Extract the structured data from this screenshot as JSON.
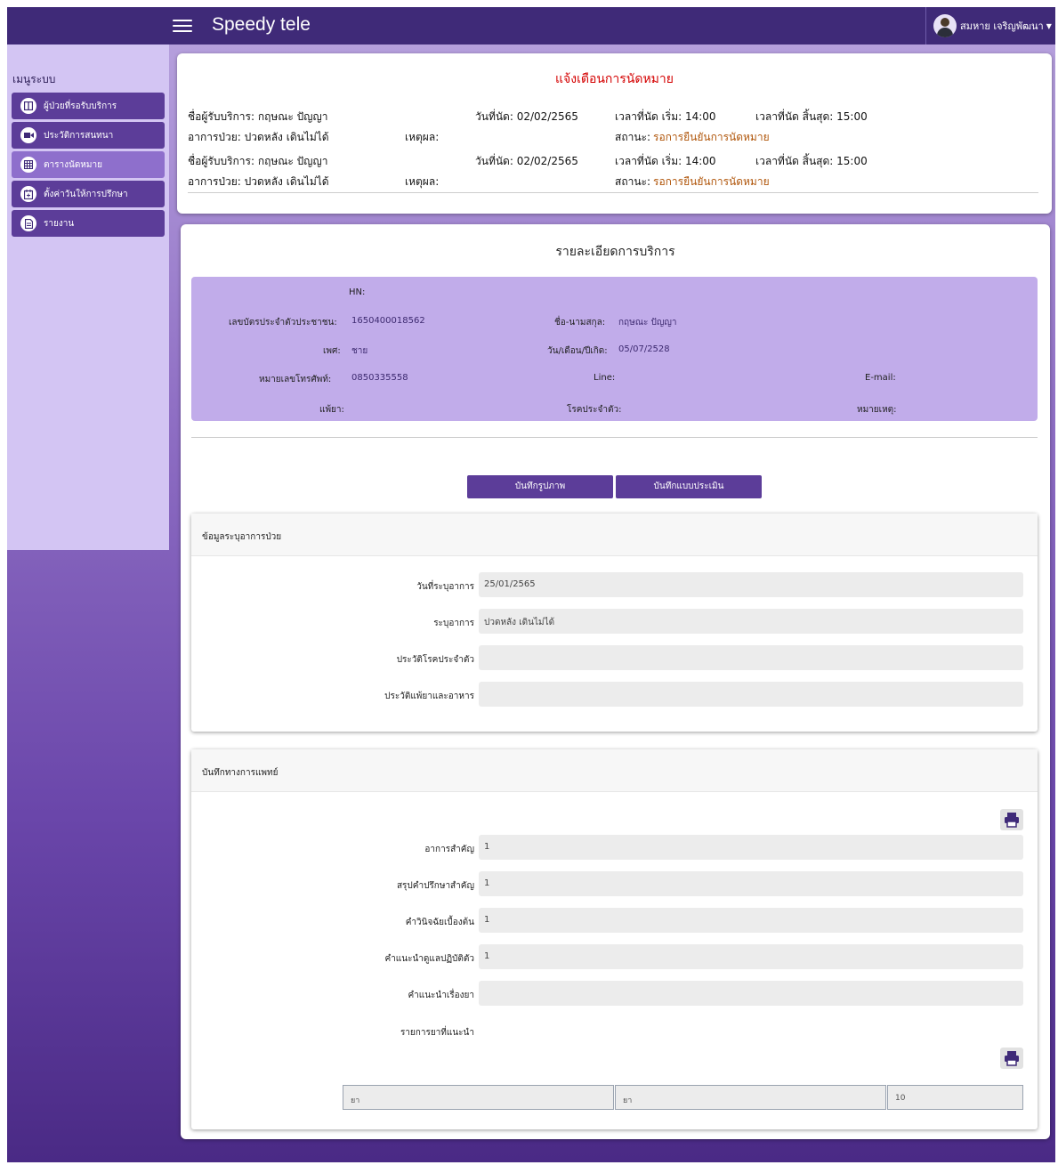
{
  "app": {
    "title": "Speedy tele",
    "user": "สมหาย เจริญพัฒนา"
  },
  "sidebar": {
    "title": "เมนูระบบ",
    "items": [
      {
        "label": "ผู้ป่วยที่รอรับบริการ",
        "icon": "columns-icon"
      },
      {
        "label": "ประวัติการสนทนา",
        "icon": "video-icon"
      },
      {
        "label": "ตารางนัดหมาย",
        "icon": "calendar-grid-icon"
      },
      {
        "label": "ตั้งค่าวันให้การปรึกษา",
        "icon": "calendar-plus-icon"
      },
      {
        "label": "รายงาน",
        "icon": "document-icon"
      }
    ]
  },
  "alert": {
    "title": "แจ้งเตือนการนัดหมาย",
    "rows": [
      {
        "client": "ชื่อผู้รับบริการ: กฤษณะ ปัญญา",
        "date": "วันที่นัด: 02/02/2565",
        "start": "เวลาที่นัด เริ่ม: 14:00",
        "end": "เวลาที่นัด สิ้นสุด: 15:00",
        "symptom": "อาการป่วย: ปวดหลัง เดินไม่ได้",
        "reason": "เหตุผล:",
        "status_label": "สถานะ:",
        "status_value": "รอการยืนยันการนัดหมาย"
      },
      {
        "client": "ชื่อผู้รับบริการ: กฤษณะ ปัญญา",
        "date": "วันที่นัด: 02/02/2565",
        "start": "เวลาที่นัด เริ่ม: 14:00",
        "end": "เวลาที่นัด สิ้นสุด: 15:00",
        "symptom": "อาการป่วย: ปวดหลัง เดินไม่ได้",
        "reason": "เหตุผล:",
        "status_label": "สถานะ:",
        "status_value": "รอการยืนยันการนัดหมาย"
      }
    ]
  },
  "detail": {
    "title": "รายละเอียดการบริการ",
    "patient": {
      "hn_label": "HN:",
      "id_label": "เลขบัตรประจำตัวประชาชน:",
      "id_value": "1650400018562",
      "name_label": "ชื่อ-นามสกุล:",
      "name_value": "กฤษณะ ปัญญา",
      "sex_label": "เพศ:",
      "sex_value": "ชาย",
      "dob_label": "วัน/เดือน/ปีเกิด:",
      "dob_value": "05/07/2528",
      "phone_label": "หมายเลขโทรศัพท์:",
      "phone_value": "0850335558",
      "line_label": "Line:",
      "email_label": "E-mail:",
      "allergy_label": "แพ้ยา:",
      "disease_label": "โรคประจำตัว:",
      "note_label": "หมายเหตุ:"
    },
    "buttons": {
      "photo": "บันทึกรูปภาพ",
      "assessment": "บันทึกแบบประเมิน"
    },
    "symptoms": {
      "title": "ข้อมูลระบุอาการป่วย",
      "fields": [
        {
          "label": "วันที่ระบุอาการ",
          "value": "25/01/2565"
        },
        {
          "label": "ระบุอาการ",
          "value": "ปวดหลัง เดินไม่ได้"
        },
        {
          "label": "ประวัติโรคประจำตัว",
          "value": ""
        },
        {
          "label": "ประวัติแพ้ยาและอาหาร",
          "value": ""
        }
      ]
    },
    "medical": {
      "title": "บันทึกทางการแพทย์",
      "fields": [
        {
          "label": "อาการสำคัญ",
          "value": "1"
        },
        {
          "label": "สรุปคำปรึกษาสำคัญ",
          "value": "1"
        },
        {
          "label": "คำวินิจฉัยเบื้องต้น",
          "value": "1"
        },
        {
          "label": "คำแนะนำดูแลปฏิบัติตัว",
          "value": "1"
        },
        {
          "label": "คำแนะนำเรื่องยา",
          "value": ""
        }
      ],
      "drug_list_label": "รายการยาที่แนะนำ",
      "drug_row": [
        "ยา",
        "ยา",
        "10"
      ]
    }
  }
}
